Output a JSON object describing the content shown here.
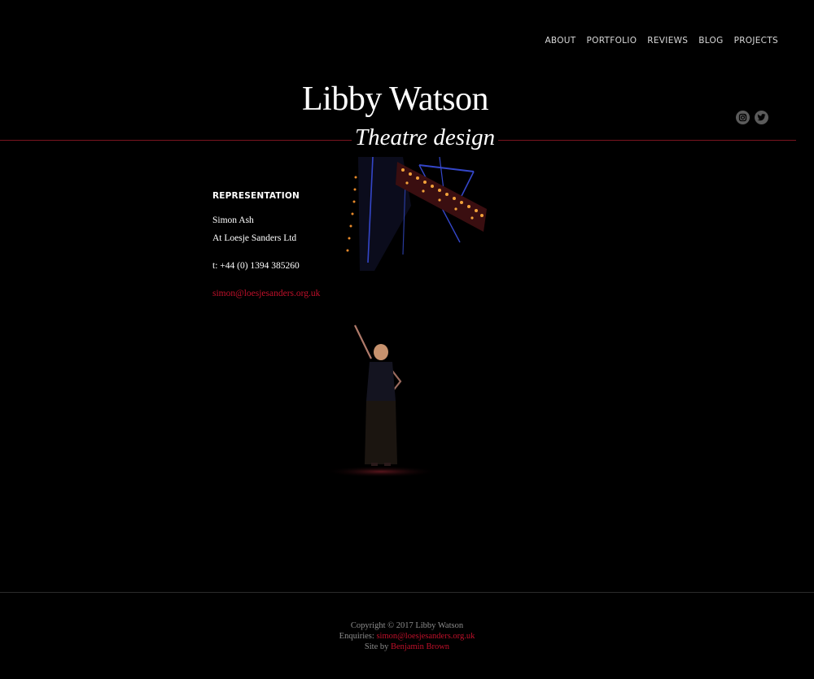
{
  "nav": {
    "items": [
      "ABOUT",
      "PORTFOLIO",
      "REVIEWS",
      "BLOG",
      "PROJECTS"
    ]
  },
  "header": {
    "title": "Libby Watson",
    "tagline": "Theatre design"
  },
  "social": {
    "icons": [
      "instagram-icon",
      "twitter-icon"
    ]
  },
  "representation": {
    "heading": "REPRESENTATION",
    "name": "Simon Ash",
    "agency": "At Loesje Sanders Ltd",
    "phone": "t:  +44 (0) 1394 385260",
    "email": "simon@loesjesanders.org.uk"
  },
  "footer": {
    "copyright": "Copyright © 2017 Libby Watson",
    "enquiries_label": "Enquiries: ",
    "enquiries_email": "simon@loesjesanders.org.uk",
    "site_by_label": "Site by ",
    "site_by_name": "Benjamin Brown"
  },
  "colors": {
    "background": "#000000",
    "accent": "#c0102a",
    "rule": "#7a1520"
  }
}
